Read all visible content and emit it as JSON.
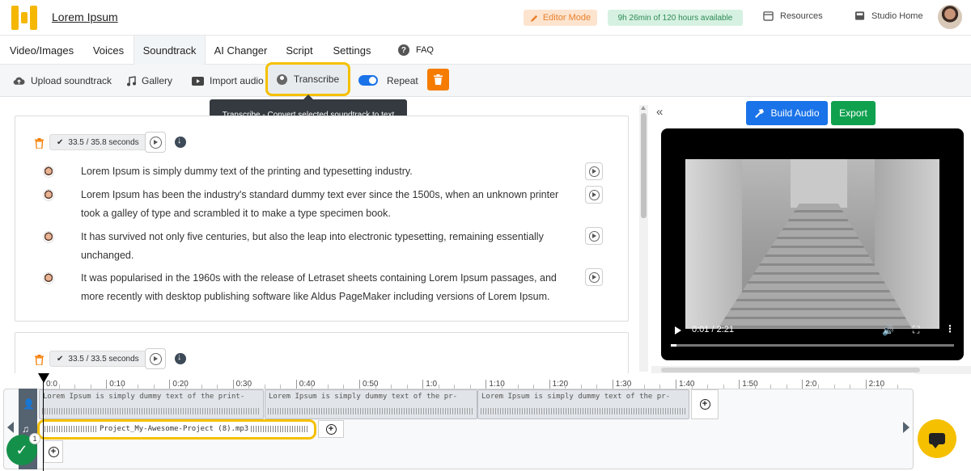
{
  "header": {
    "brand": "Lorem Ipsum",
    "editor_mode": "Editor Mode",
    "hours": "9h 26min of 120 hours available",
    "resources": "Resources",
    "studio_home": "Studio Home"
  },
  "tabs": [
    {
      "label": "Video/Images"
    },
    {
      "label": "Voices"
    },
    {
      "label": "Soundtrack",
      "active": true
    },
    {
      "label": "AI Changer"
    },
    {
      "label": "Script"
    },
    {
      "label": "Settings"
    },
    {
      "label": "FAQ"
    }
  ],
  "toolbar": {
    "upload": "Upload soundtrack",
    "gallery": "Gallery",
    "import": "Import audio",
    "transcribe": "Transcribe",
    "repeat": "Repeat",
    "repeat_on": true,
    "tooltip": "Transcribe - Convert selected soundtrack to text"
  },
  "cards": [
    {
      "duration": "33.5 / 35.8 seconds",
      "paragraphs": [
        "Lorem Ipsum is simply dummy text of the printing and typesetting industry.",
        "Lorem Ipsum has been the industry's standard dummy text ever since the 1500s, when an unknown printer took a galley of type and scrambled it to make a type specimen book.",
        "It has survived not only five centuries, but also the leap into electronic typesetting, remaining essentially unchanged.",
        "It was popularised in the 1960s with the release of Letraset sheets containing Lorem Ipsum passages, and more recently with desktop publishing software like Aldus PageMaker including versions of Lorem Ipsum."
      ]
    },
    {
      "duration": "33.5 / 33.5 seconds"
    }
  ],
  "right_panel": {
    "build_audio": "Build Audio",
    "export": "Export",
    "time": "0:01 / 2:21",
    "progress": 0.02
  },
  "timeline": {
    "ticks": [
      "0:0",
      "0:10",
      "0:20",
      "0:30",
      "0:40",
      "0:50",
      "1:0",
      "1:10",
      "1:20",
      "1:30",
      "1:40",
      "1:50",
      "2:0",
      "2:10"
    ],
    "segments": [
      "Lorem Ipsum is simply dummy text of the print-",
      "Lorem Ipsum is simply dummy text of the pr-",
      "Lorem Ipsum is simply dummy text of the pr-"
    ],
    "audio_file": "Project_My-Awesome-Project (8).mp3",
    "tasks_count": "1"
  },
  "colors": {
    "accent_blue": "#1a73e8",
    "export_green": "#10a14f",
    "highlight_yellow": "#f5c000",
    "delete_orange": "#f57c00"
  }
}
